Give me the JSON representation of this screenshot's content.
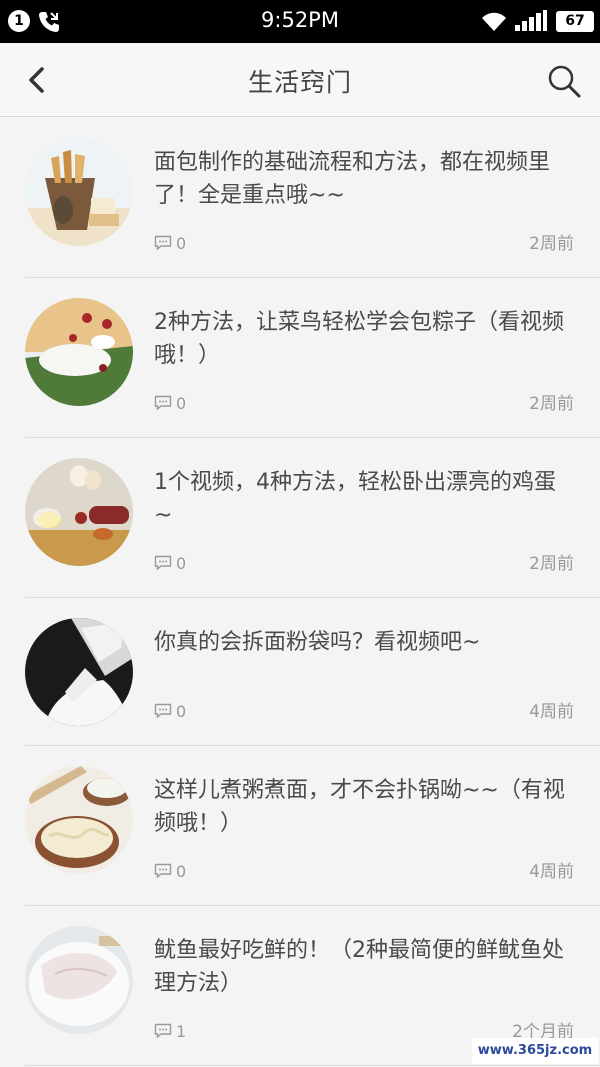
{
  "status_bar": {
    "notification_count": "1",
    "time": "9:52PM",
    "battery": "67"
  },
  "header": {
    "title": "生活窍门"
  },
  "articles": [
    {
      "title": "面包制作的基础流程和方法，都在视频里了！全是重点哦~~",
      "comments": "0",
      "time": "2周前",
      "thumb": "bread"
    },
    {
      "title": "2种方法，让菜鸟轻松学会包粽子（看视频哦！）",
      "comments": "0",
      "time": "2周前",
      "thumb": "zongzi"
    },
    {
      "title": "1个视频，4种方法，轻松卧出漂亮的鸡蛋~",
      "comments": "0",
      "time": "2周前",
      "thumb": "eggs"
    },
    {
      "title": "你真的会拆面粉袋吗？看视频吧~",
      "comments": "0",
      "time": "4周前",
      "thumb": "flour"
    },
    {
      "title": "这样儿煮粥煮面，才不会扑锅呦~~（有视频哦！）",
      "comments": "0",
      "time": "4周前",
      "thumb": "noodles"
    },
    {
      "title": "鱿鱼最好吃鲜的！（2种最简便的鲜鱿鱼处理方法）",
      "comments": "1",
      "time": "2个月前",
      "thumb": "squid"
    }
  ],
  "watermark": "www.365jz.com"
}
